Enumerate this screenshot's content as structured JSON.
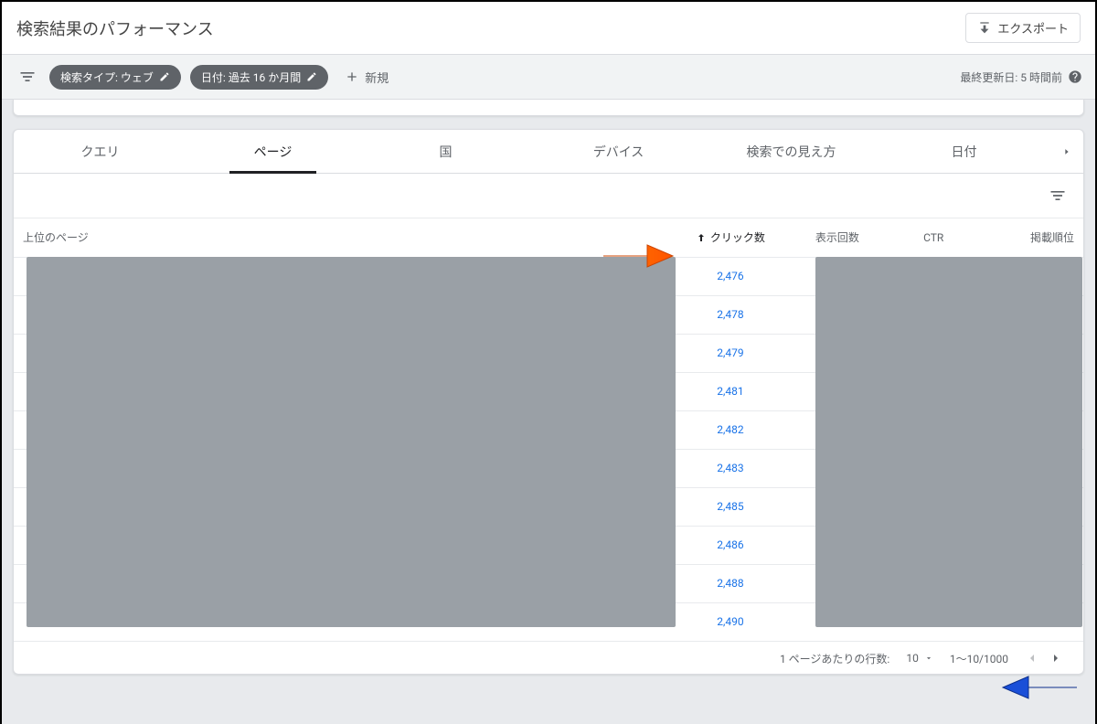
{
  "header": {
    "title": "検索結果のパフォーマンス",
    "export_label": "エクスポート"
  },
  "filters": {
    "chip_search_type": "検索タイプ: ウェブ",
    "chip_date": "日付: 過去 16 か月間",
    "add_new_label": "新規",
    "last_updated": "最終更新日: 5 時間前"
  },
  "tabs": {
    "items": [
      {
        "label": "クエリ",
        "active": false
      },
      {
        "label": "ページ",
        "active": true
      },
      {
        "label": "国",
        "active": false
      },
      {
        "label": "デバイス",
        "active": false
      },
      {
        "label": "検索での見え方",
        "active": false
      },
      {
        "label": "日付",
        "active": false
      }
    ]
  },
  "table": {
    "headers": {
      "page": "上位のページ",
      "clicks": "クリック数",
      "impressions": "表示回数",
      "ctr": "CTR",
      "position": "掲載順位"
    },
    "rows": [
      {
        "clicks": "2,476"
      },
      {
        "clicks": "2,478"
      },
      {
        "clicks": "2,479"
      },
      {
        "clicks": "2,481"
      },
      {
        "clicks": "2,482"
      },
      {
        "clicks": "2,483"
      },
      {
        "clicks": "2,485"
      },
      {
        "clicks": "2,486"
      },
      {
        "clicks": "2,488"
      },
      {
        "clicks": "2,490"
      }
    ]
  },
  "pagination": {
    "rows_per_page_label": "1 ページあたりの行数:",
    "rows_per_page_value": "10",
    "range": "1～10/1000"
  }
}
